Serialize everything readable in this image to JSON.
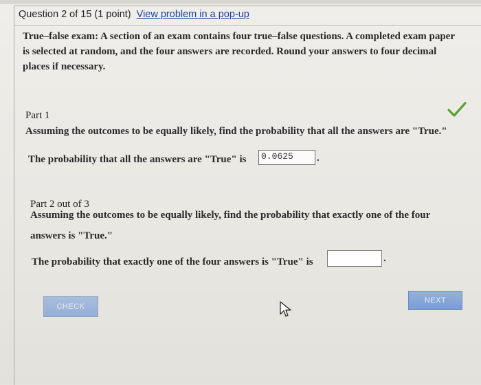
{
  "header": {
    "question_label": "Question 2 of 15 (1 point)",
    "popup_link": "View problem in a pop-up"
  },
  "problem": {
    "text": "True–false exam: A section of an exam contains four true–false questions. A completed exam paper is selected at random, and the four answers are recorded. Round your answers to four decimal places if necessary."
  },
  "part1": {
    "label": "Part 1",
    "question": "Assuming the outcomes to be equally likely, find the probability that all the answers are \"True.\"",
    "answer_prefix": "The probability that all the answers are \"True\" is",
    "answer_value": "0.0625",
    "answer_suffix": "."
  },
  "part2": {
    "label": "Part 2 out of 3",
    "question_line1": "Assuming the outcomes to be equally likely, find the probability that exactly one of the four",
    "question_line2": "answers is \"True.\"",
    "answer_prefix": "The probability that exactly one of the four answers is \"True\" is",
    "answer_value": "",
    "answer_suffix": "."
  },
  "buttons": {
    "check": "CHECK",
    "next": "NEXT"
  },
  "colors": {
    "link": "#1f3f99",
    "check_mark": "#5aa02c",
    "button": "#7b9dd2"
  },
  "icons": {
    "correct": "check-mark-icon",
    "pointer": "mouse-cursor-icon"
  }
}
